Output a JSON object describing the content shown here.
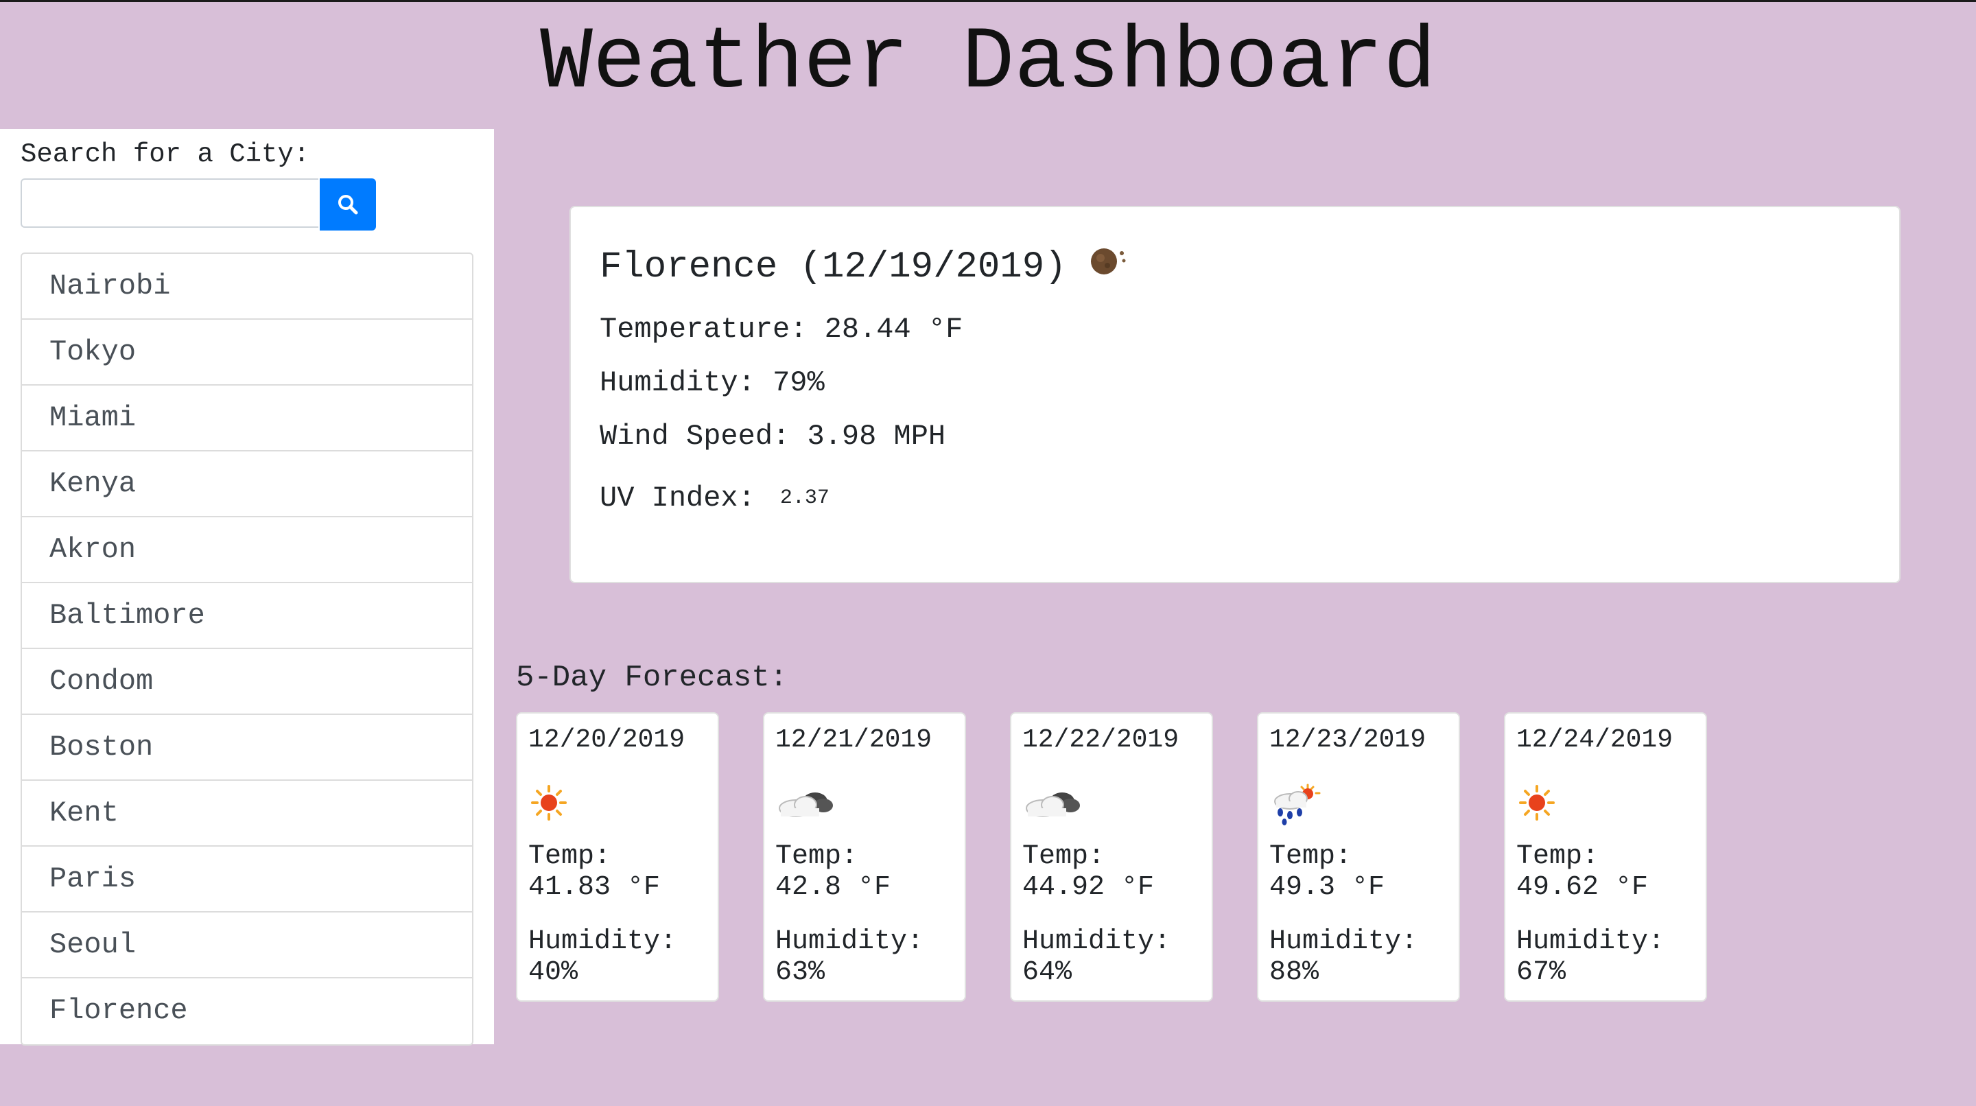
{
  "header": {
    "title": "Weather Dashboard"
  },
  "sidebar": {
    "search_label": "Search for a City:",
    "search_value": "",
    "search_button_icon": "search-icon",
    "cities": [
      "Nairobi",
      "Tokyo",
      "Miami",
      "Kenya",
      "Akron",
      "Baltimore",
      "Condom",
      "Boston",
      "Kent",
      "Paris",
      "Seoul",
      "Florence"
    ]
  },
  "current": {
    "city": "Florence",
    "date": "(12/19/2019)",
    "icon": "moon-icon",
    "temperature_label": "Temperature:",
    "temperature_value": "28.44 °F",
    "humidity_label": "Humidity:",
    "humidity_value": "79%",
    "wind_label": "Wind Speed:",
    "wind_value": "3.98 MPH",
    "uv_label": "UV Index:",
    "uv_value": "2.37"
  },
  "forecast": {
    "title": "5-Day Forecast:",
    "days": [
      {
        "date": "12/20/2019",
        "icon": "sun-icon",
        "temp_label": "Temp:",
        "temp": "41.83 °F",
        "humidity_label": "Humidity:",
        "humidity": "40%"
      },
      {
        "date": "12/21/2019",
        "icon": "cloudy-icon",
        "temp_label": "Temp:",
        "temp": "42.8 °F",
        "humidity_label": "Humidity:",
        "humidity": "63%"
      },
      {
        "date": "12/22/2019",
        "icon": "cloudy-icon",
        "temp_label": "Temp:",
        "temp": "44.92 °F",
        "humidity_label": "Humidity:",
        "humidity": "64%"
      },
      {
        "date": "12/23/2019",
        "icon": "rain-sun-icon",
        "temp_label": "Temp:",
        "temp": "49.3 °F",
        "humidity_label": "Humidity:",
        "humidity": "88%"
      },
      {
        "date": "12/24/2019",
        "icon": "sun-icon",
        "temp_label": "Temp:",
        "temp": "49.62 °F",
        "humidity_label": "Humidity:",
        "humidity": "67%"
      }
    ]
  },
  "colors": {
    "background": "#d8bfd8",
    "button": "#007bff",
    "card": "#ffffff"
  }
}
